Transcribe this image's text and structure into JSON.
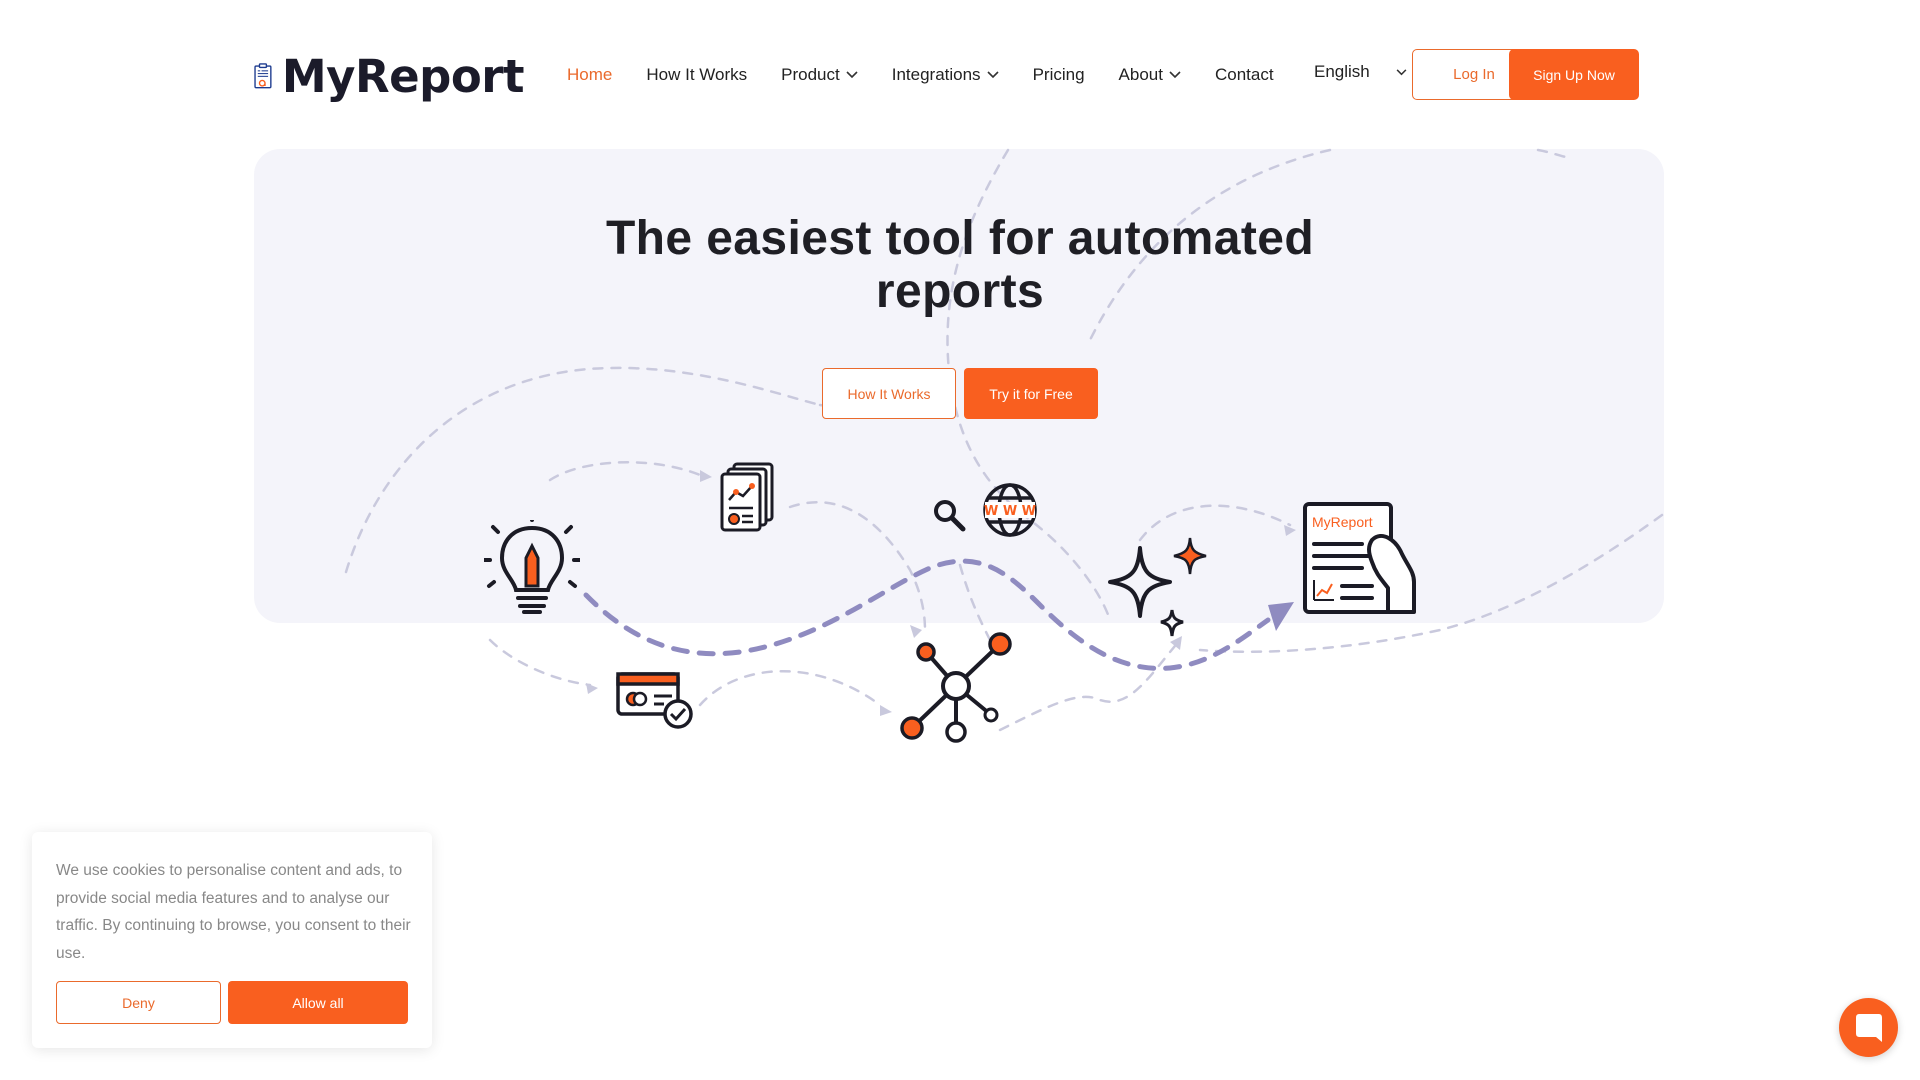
{
  "brand": {
    "name": "MyReport"
  },
  "nav": {
    "items": [
      {
        "label": "Home",
        "active": true,
        "dropdown": false
      },
      {
        "label": "How It Works",
        "active": false,
        "dropdown": false
      },
      {
        "label": "Product",
        "active": false,
        "dropdown": true
      },
      {
        "label": "Integrations",
        "active": false,
        "dropdown": true
      },
      {
        "label": "Pricing",
        "active": false,
        "dropdown": false
      },
      {
        "label": "About",
        "active": false,
        "dropdown": true
      },
      {
        "label": "Contact",
        "active": false,
        "dropdown": false
      }
    ],
    "language": "English",
    "login_label": "Log In",
    "signup_label": "Sign Up Now"
  },
  "hero": {
    "title": "The easiest tool for automated reports",
    "how_label": "How It Works",
    "try_label": "Try it for Free",
    "report_badge": "MyReport",
    "www_label": "W W W"
  },
  "cookie": {
    "text": "We use cookies to personalise content and ads, to provide social media features and to analyse our traffic. By continuing to browse, you consent to their use.",
    "deny_label": "Deny",
    "allow_label": "Allow all"
  },
  "colors": {
    "accent": "#f95f1f",
    "accent_text": "#ea6a2c",
    "hero_bg": "#f4f4fa",
    "deco_line": "#8f8bc0",
    "logo_blue": "#1d3b8f"
  },
  "icons": [
    "lightbulb-icon",
    "report-pages-icon",
    "search-icon",
    "globe-icon",
    "sparkles-icon",
    "report-hand-icon",
    "payment-card-icon",
    "network-icon",
    "chat-icon"
  ]
}
